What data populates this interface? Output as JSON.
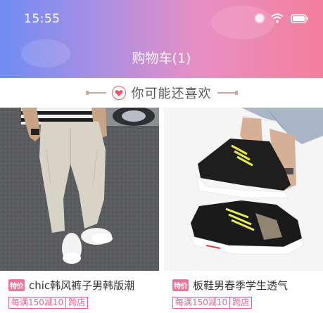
{
  "status_bar": {
    "time": "15:55"
  },
  "header": {
    "title": "购物车(1)"
  },
  "recommend": {
    "label": "你可能还喜欢"
  },
  "products": [
    {
      "hot_tag": "特价",
      "name": "chic韩风裤子男韩版潮",
      "promo": "每满150减10",
      "cross_shop": "跨店"
    },
    {
      "hot_tag": "特价",
      "name": "板鞋男春季学生透气",
      "promo": "每满150减10",
      "cross_shop": "跨店"
    }
  ],
  "colors": {
    "accent": "#ef5f8d",
    "heart": "#e65a6d",
    "gradient_start": "#6f8cf2",
    "gradient_end": "#f47f9c"
  },
  "icons": [
    "signal-icon",
    "wifi-icon",
    "battery-icon",
    "heart-icon"
  ]
}
